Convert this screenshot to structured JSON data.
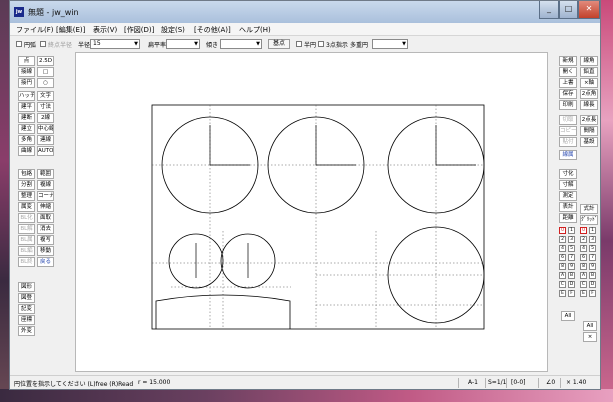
{
  "window": {
    "title": "無題 - jw_win",
    "app_icon_label": "jw"
  },
  "menu": [
    "ファイル(F)",
    "[編集(E)]",
    "表示(V)",
    "[作図(D)]",
    "設定(S)",
    "[その他(A)]",
    "ヘルプ(H)"
  ],
  "toolbar": {
    "rectangle_label": "円弧",
    "ellipse_label": "終点半径",
    "radius_label": "半径",
    "radius_value": "15",
    "flat_ratio_label": "扁平率",
    "tilt_label": "傾き",
    "base_point_button": "基点",
    "half_circle_label": "半円",
    "three_point_label": "3点指示",
    "multi_circle_label": "多重円"
  },
  "left_tools": [
    [
      "点",
      "2.5D"
    ],
    [
      "接線",
      "□"
    ],
    [
      "接円",
      "○"
    ],
    [
      "ハッチ",
      "文字"
    ],
    [
      "建平",
      "寸法"
    ],
    [
      "建断",
      "2線"
    ],
    [
      "建立",
      "中心線"
    ],
    [
      "多角",
      "連線"
    ],
    [
      "曲線",
      "AUTO"
    ],
    [
      "包絡",
      "範囲"
    ],
    [
      "分割",
      "複線"
    ],
    [
      "整理",
      "コーナー"
    ],
    [
      "属変",
      "伸縮"
    ],
    [
      "BL化",
      "面取"
    ],
    [
      "BL解",
      "消去"
    ],
    [
      "BL属",
      "複写"
    ],
    [
      "BL編",
      "移動"
    ],
    [
      "BL終",
      "戻る"
    ],
    [
      "図形"
    ],
    [
      "図登"
    ],
    [
      "記変"
    ],
    [
      "座標"
    ],
    [
      "外変"
    ]
  ],
  "right_tools": [
    "新規",
    "開く",
    "上書",
    "保存",
    "印刷",
    "切取",
    "コピー",
    "貼付",
    "線属",
    "寸化",
    "寸解",
    "測定",
    "表計",
    "距離",
    "式計",
    "ｸﾞﾘｯﾄﾞ"
  ],
  "right_tools_2": [
    "線角",
    "鉛直",
    "×軸",
    "2点角",
    "線長",
    "2点長",
    "間隔",
    "基設"
  ],
  "layer_panel": {
    "all_label": "All",
    "all_label_2": "All",
    "group_cells": [
      "0",
      "1",
      "2",
      "3",
      "4",
      "5",
      "6",
      "7",
      "8",
      "9",
      "A",
      "B",
      "C",
      "D",
      "E",
      "F"
    ],
    "layer_cells": [
      "0",
      "1",
      "2",
      "3",
      "4",
      "5",
      "6",
      "7",
      "8",
      "9",
      "A",
      "B",
      "C",
      "D",
      "E",
      "F"
    ],
    "reset_button": "×"
  },
  "statusbar": {
    "message": "円位置を指示してください (L)free (R)Read",
    "radius_readout": "r = 15.000",
    "paper_size": "A-1",
    "scale": "S=1/1",
    "layer": "[0-0]",
    "angle": "∠0",
    "zoom": "× 1.40"
  },
  "drawing": {
    "stroke_color": "#000000",
    "circles_count": 6
  }
}
